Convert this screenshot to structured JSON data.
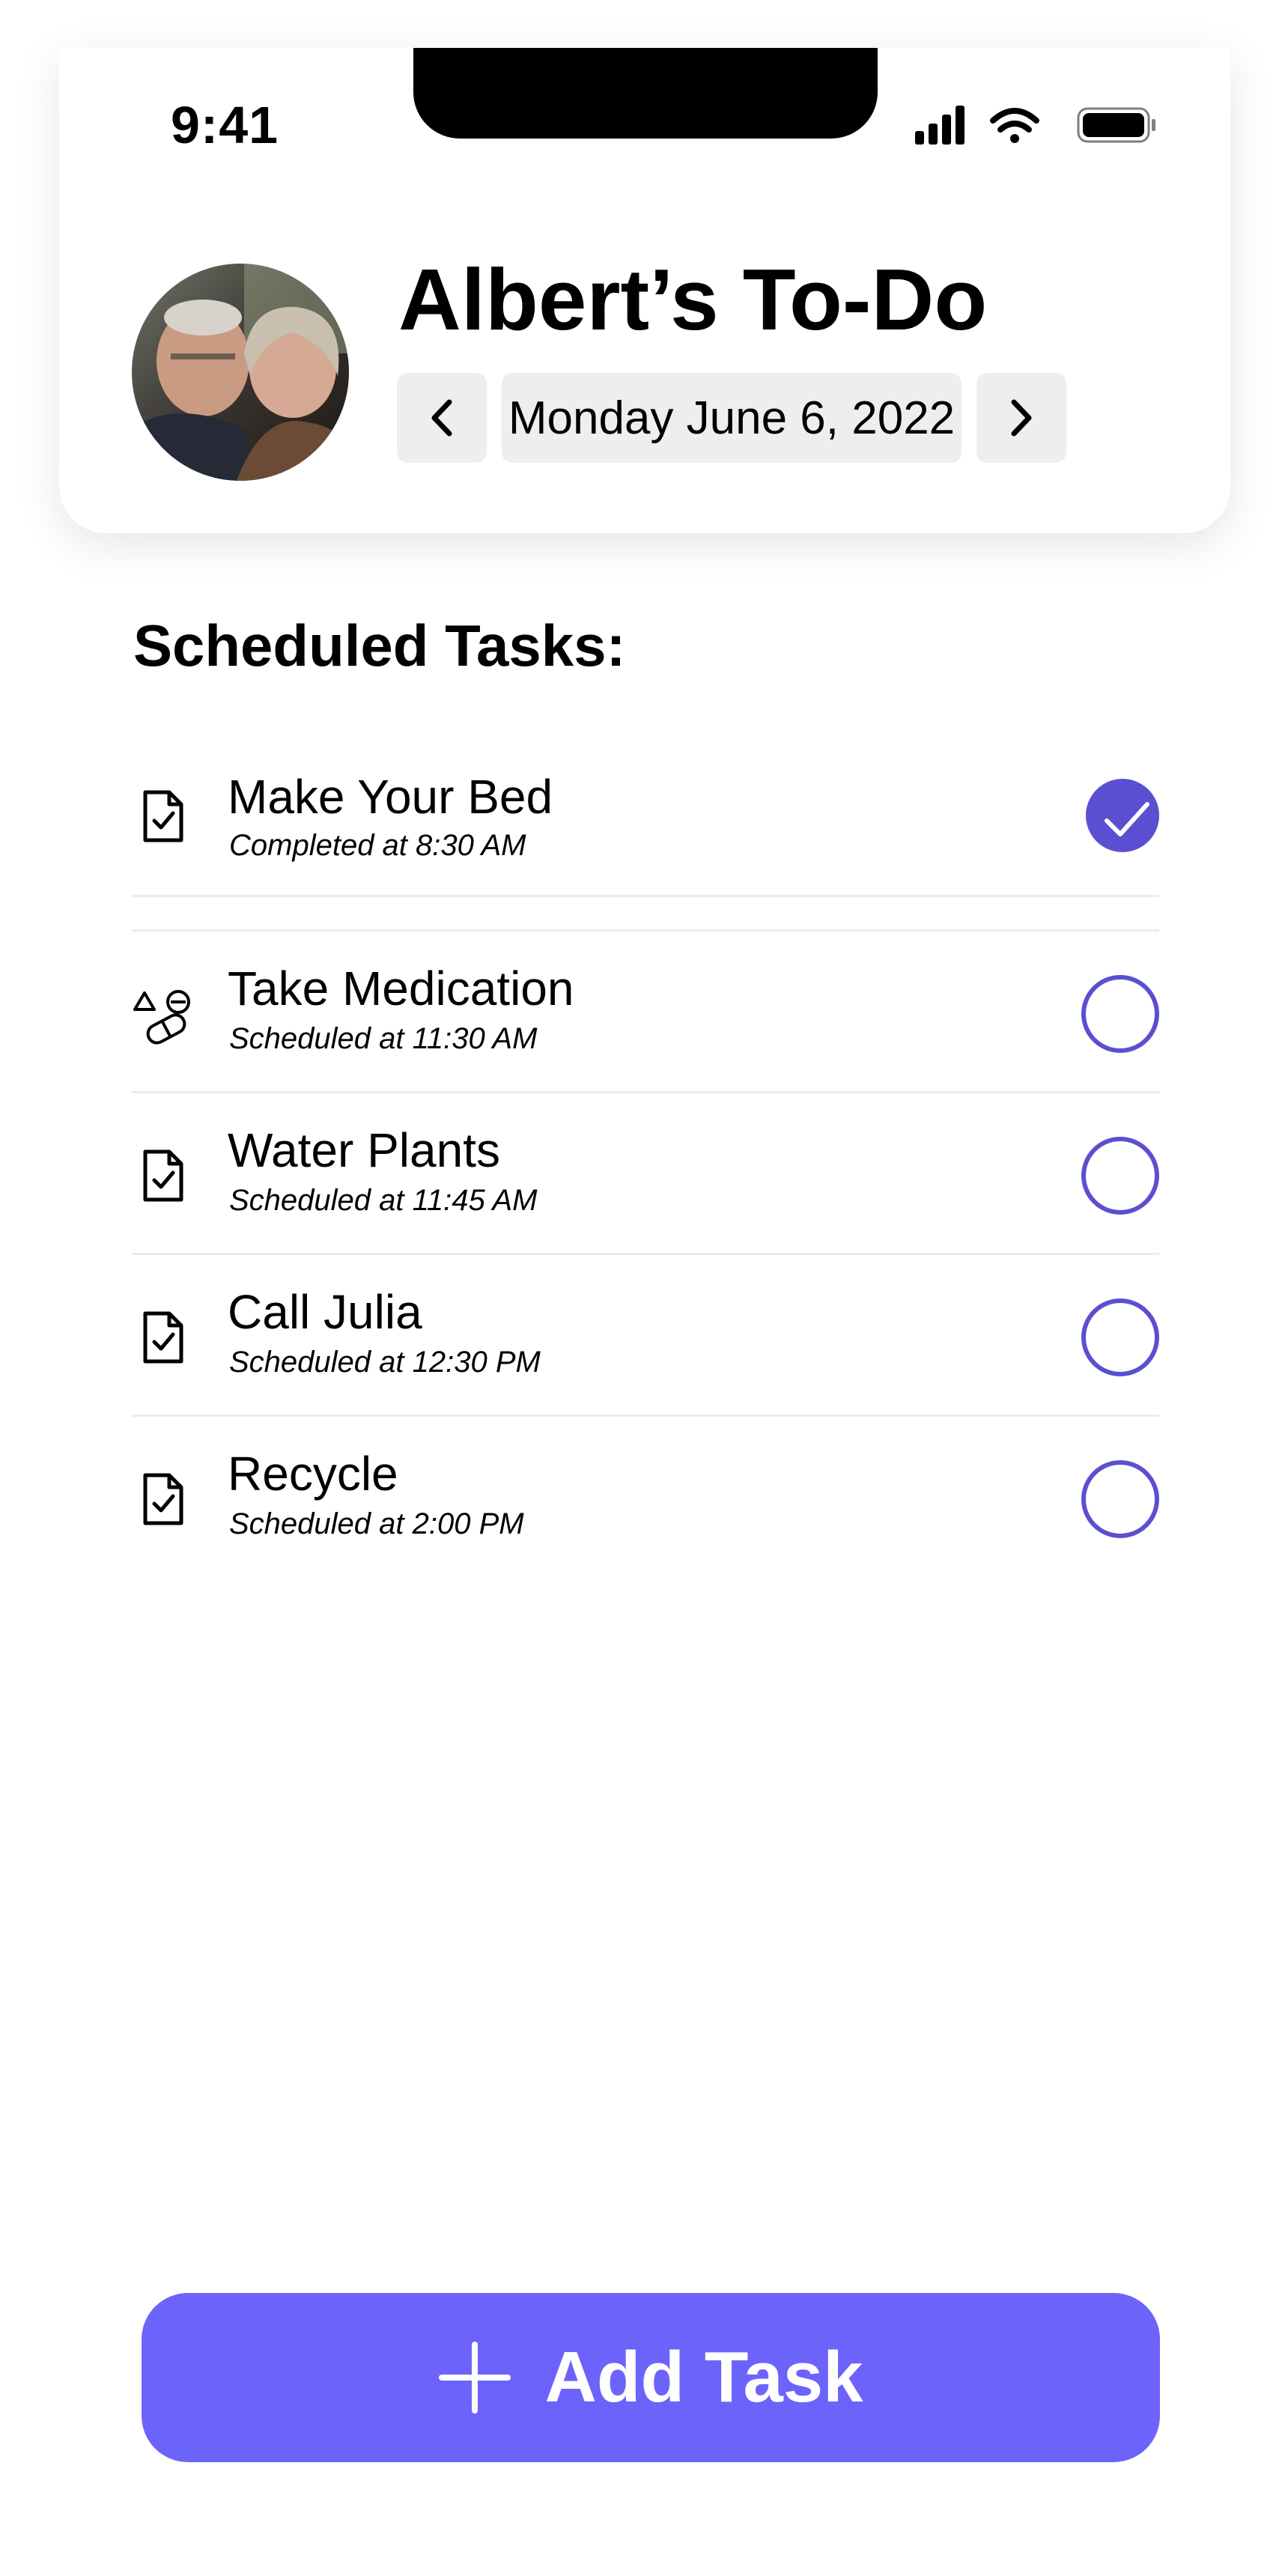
{
  "status_bar": {
    "time": "9:41"
  },
  "header": {
    "title": "Albert’s To-Do",
    "date": "Monday June 6, 2022"
  },
  "section": {
    "title": "Scheduled Tasks:"
  },
  "tasks": [
    {
      "name": "Make Your Bed",
      "time": "Completed at 8:30 AM",
      "icon": "document-check-icon",
      "completed": true
    },
    {
      "name": "Take Medication",
      "time": "Scheduled at 11:30 AM",
      "icon": "pills-icon",
      "completed": false
    },
    {
      "name": "Water Plants",
      "time": "Scheduled at 11:45 AM",
      "icon": "document-check-icon",
      "completed": false
    },
    {
      "name": "Call Julia",
      "time": "Scheduled at 12:30 PM",
      "icon": "document-check-icon",
      "completed": false
    },
    {
      "name": "Recycle",
      "time": "Scheduled at 2:00 PM",
      "icon": "document-check-icon",
      "completed": false
    }
  ],
  "add_button": {
    "label": "Add Task"
  },
  "colors": {
    "accent": "#5b4fd1",
    "button": "#6c63fb",
    "chip_bg": "#eeeeee"
  }
}
